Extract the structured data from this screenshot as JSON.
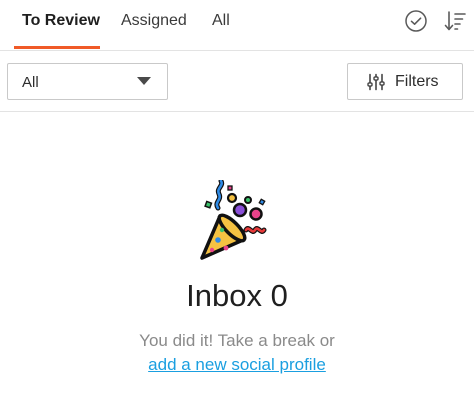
{
  "tabs": [
    {
      "label": "To Review",
      "active": true
    },
    {
      "label": "Assigned",
      "active": false
    },
    {
      "label": "All",
      "active": false
    }
  ],
  "header_icons": [
    "check-circle-icon",
    "sort-icon"
  ],
  "filter": {
    "select_value": "All",
    "filters_label": "Filters",
    "filters_icon": "sliders-icon"
  },
  "empty_state": {
    "illustration": "party-popper-icon",
    "title": "Inbox 0",
    "text": "You did it! Take a break or",
    "link": "add a new social profile"
  },
  "colors": {
    "accent": "#f05a28",
    "link": "#1a9fe0",
    "muted_text": "#8a8a8a"
  }
}
